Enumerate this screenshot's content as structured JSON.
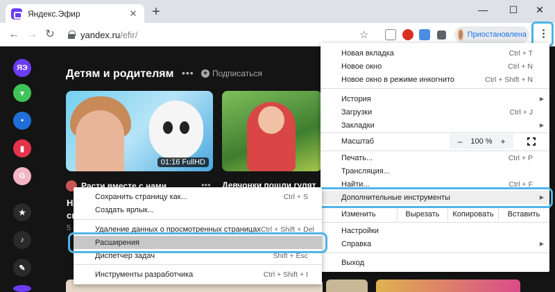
{
  "browser": {
    "tab_title": "Яндекс.Эфир",
    "tab_close": "✕",
    "new_tab": "+",
    "window_minimize": "—",
    "window_maximize": "☐",
    "window_close": "✕",
    "url_host": "yandex.ru",
    "url_path": "/efir/",
    "profile_label": "Приостановлена",
    "icons": [
      "back-arrow-icon",
      "forward-arrow-icon",
      "reload-icon",
      "lock-icon",
      "star-icon",
      "extensions-puzzle-icon",
      "menu-kebab-icon"
    ]
  },
  "page": {
    "section_title": "Детям и родителям",
    "section_dots": "•••",
    "subscribe_label": "Подписаться",
    "cards": [
      {
        "duration": "01:16 FullHD",
        "channel": "Расти вместе с нами",
        "peek_title_1": "На",
        "peek_title_2": "сп",
        "peek_meta": "5 с"
      },
      {
        "title": "Девчонки пошли гулят"
      }
    ],
    "card_dots": "•••",
    "sidebar_labels": [
      "ЯЭ",
      "G"
    ]
  },
  "chrome_menu": {
    "items": [
      {
        "label": "Новая вкладка",
        "shortcut": "Ctrl + T"
      },
      {
        "label": "Новое окно",
        "shortcut": "Ctrl + N"
      },
      {
        "label": "Новое окно в режиме инкогнито",
        "shortcut": "Ctrl + Shift + N"
      },
      {
        "label": "История",
        "shortcut": ""
      },
      {
        "label": "Загрузки",
        "shortcut": "Ctrl + J"
      },
      {
        "label": "Закладки",
        "shortcut": ""
      },
      {
        "label": "Печать...",
        "shortcut": "Ctrl + P"
      },
      {
        "label": "Трансляция...",
        "shortcut": ""
      },
      {
        "label": "Найти...",
        "shortcut": "Ctrl + F"
      },
      {
        "label": "Дополнительные инструменты",
        "shortcut": ""
      },
      {
        "label": "Настройки",
        "shortcut": ""
      },
      {
        "label": "Справка",
        "shortcut": ""
      },
      {
        "label": "Выход",
        "shortcut": ""
      }
    ],
    "zoom": {
      "label": "Масштаб",
      "minus": "–",
      "value": "100 %",
      "plus": "+"
    },
    "edit": {
      "label": "Изменить",
      "cut": "Вырезать",
      "copy": "Копировать",
      "paste": "Вставить"
    }
  },
  "submenu": {
    "items": [
      {
        "label": "Сохранить страницу как...",
        "shortcut": "Ctrl + S"
      },
      {
        "label": "Создать ярлык...",
        "shortcut": ""
      },
      {
        "label": "Удаление данных о просмотренных страницах",
        "shortcut": "Ctrl + Shift + Del"
      },
      {
        "label": "Расширения",
        "shortcut": ""
      },
      {
        "label": "Диспетчер задач",
        "shortcut": "Shift + Esc"
      },
      {
        "label": "Инструменты разработчика",
        "shortcut": "Ctrl + Shift + I"
      }
    ]
  },
  "colors": {
    "highlight": "#4fb3e8",
    "profile_text": "#1a73e8",
    "page_bg": "#141414"
  }
}
